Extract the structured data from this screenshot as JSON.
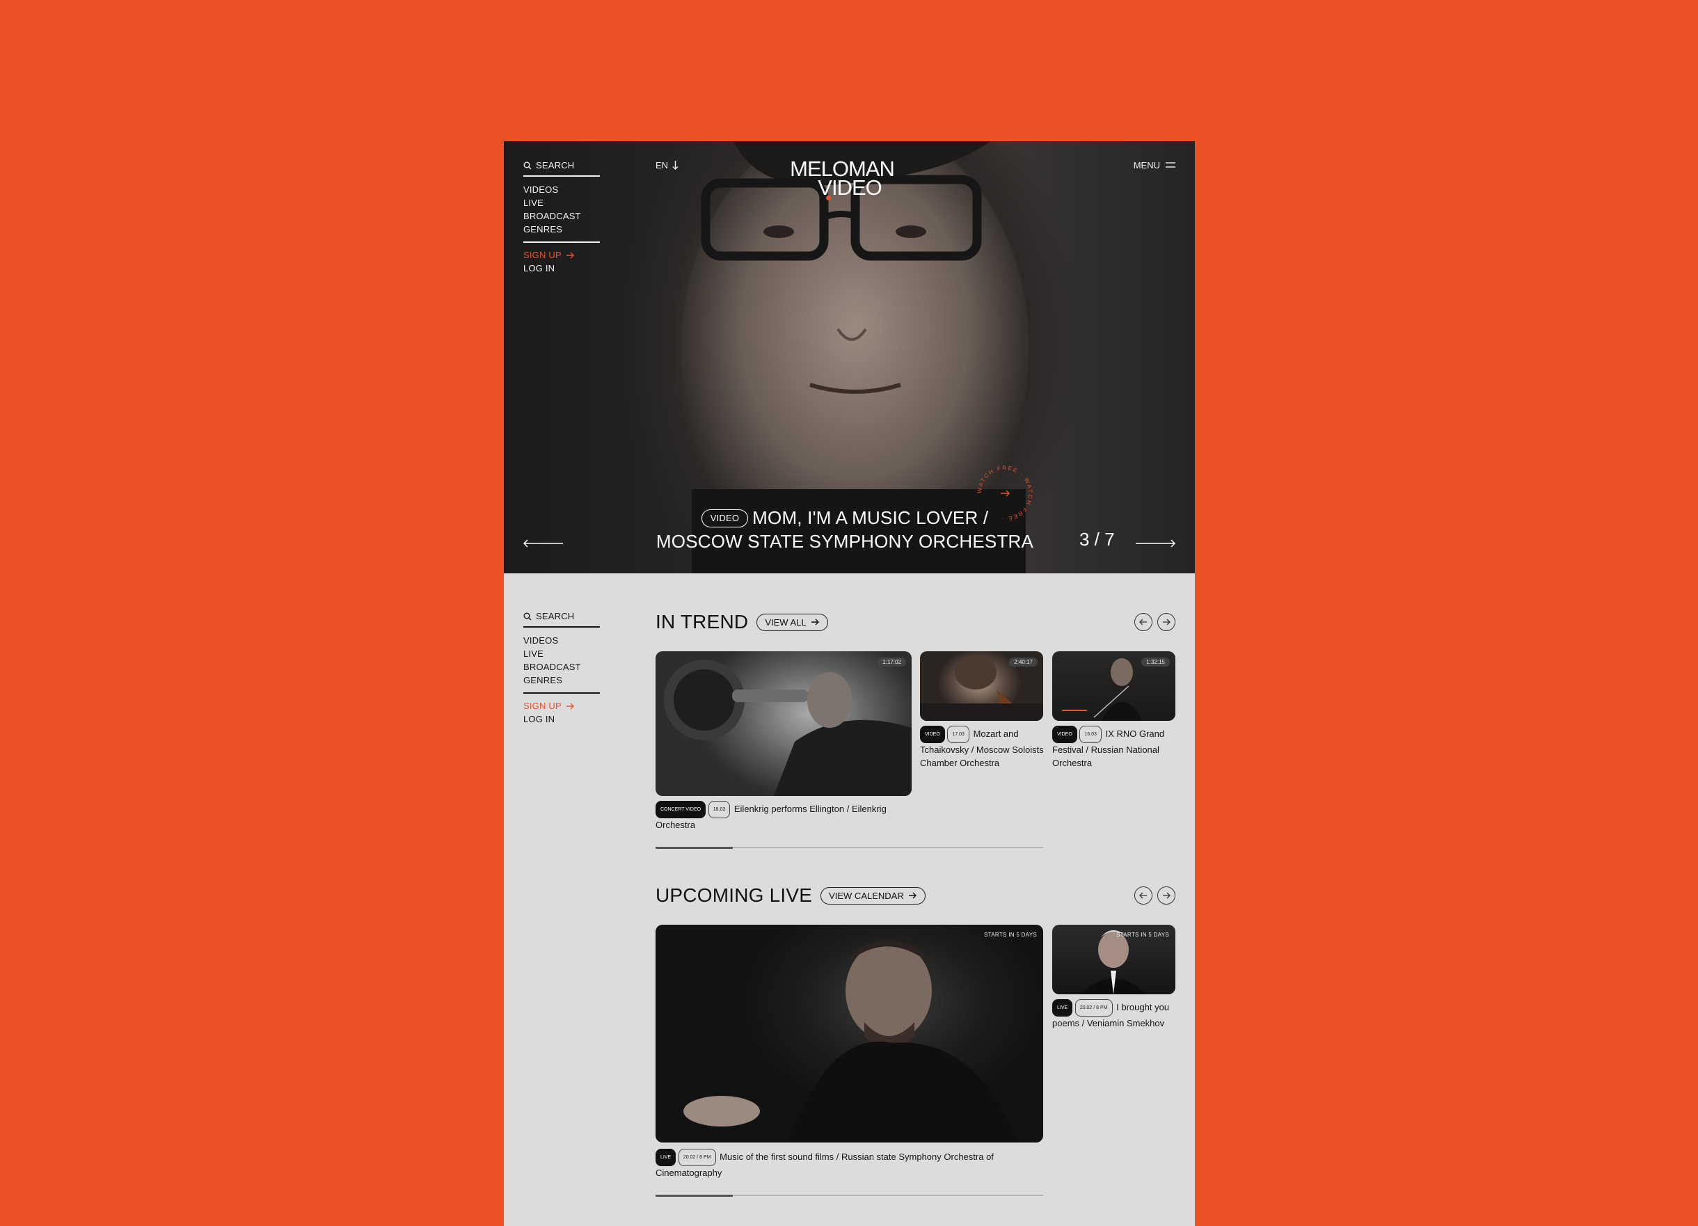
{
  "nav": {
    "search_label": "SEARCH",
    "links": [
      "VIDEOS",
      "LIVE BROADCAST",
      "GENRES"
    ],
    "signup_label": "SIGN UP",
    "login_label": "LOG IN"
  },
  "header": {
    "lang": "EN",
    "logo_line1": "MELOMAN",
    "logo_line2": "VIDEO",
    "menu_label": "MENU"
  },
  "hero": {
    "tag": "VIDEO",
    "title_line1": "MOM, I'M A MUSIC LOVER /",
    "title_line2": "MOSCOW STATE SYMPHONY ORCHESTRA",
    "counter": "3 / 7",
    "badge_text": "WATCH FREE · WATCH FREE ·"
  },
  "in_trend": {
    "title": "IN TREND",
    "view_all_label": "VIEW ALL",
    "progress": 0.2,
    "cards": [
      {
        "duration": "1:17:02",
        "tag": "CONCERT VIDEO",
        "meta": "18.03",
        "title": "Eilenkrig performs Ellington / Eilenkrig Orchestra"
      },
      {
        "duration": "2:40:17",
        "tag": "VIDEO",
        "meta": "17.03",
        "title": "Mozart and Tchaikovsky / Moscow Soloists Chamber Orchestra"
      },
      {
        "duration": "1:32:15",
        "tag": "VIDEO",
        "meta": "16.03",
        "title": "IX RNO Grand Festival / Russian National Orchestra"
      }
    ]
  },
  "upcoming_live": {
    "title": "UPCOMING LIVE",
    "view_calendar_label": "VIEW CALENDAR",
    "progress": 0.2,
    "cards": [
      {
        "starts": "STARTS IN 5 DAYS",
        "tag": "LIVE",
        "meta": "20.02 / 8 PM",
        "title": "Music of the first sound films / Russian state Symphony Orchestra of Cinematography"
      },
      {
        "starts": "STARTS IN 5 DAYS",
        "tag": "LIVE",
        "meta": "20.02 / 8 PM",
        "title": "I brought you poems / Veniamin Smekhov"
      }
    ]
  },
  "colors": {
    "accent": "#EC5128",
    "page_bg": "#DCDCDC"
  }
}
